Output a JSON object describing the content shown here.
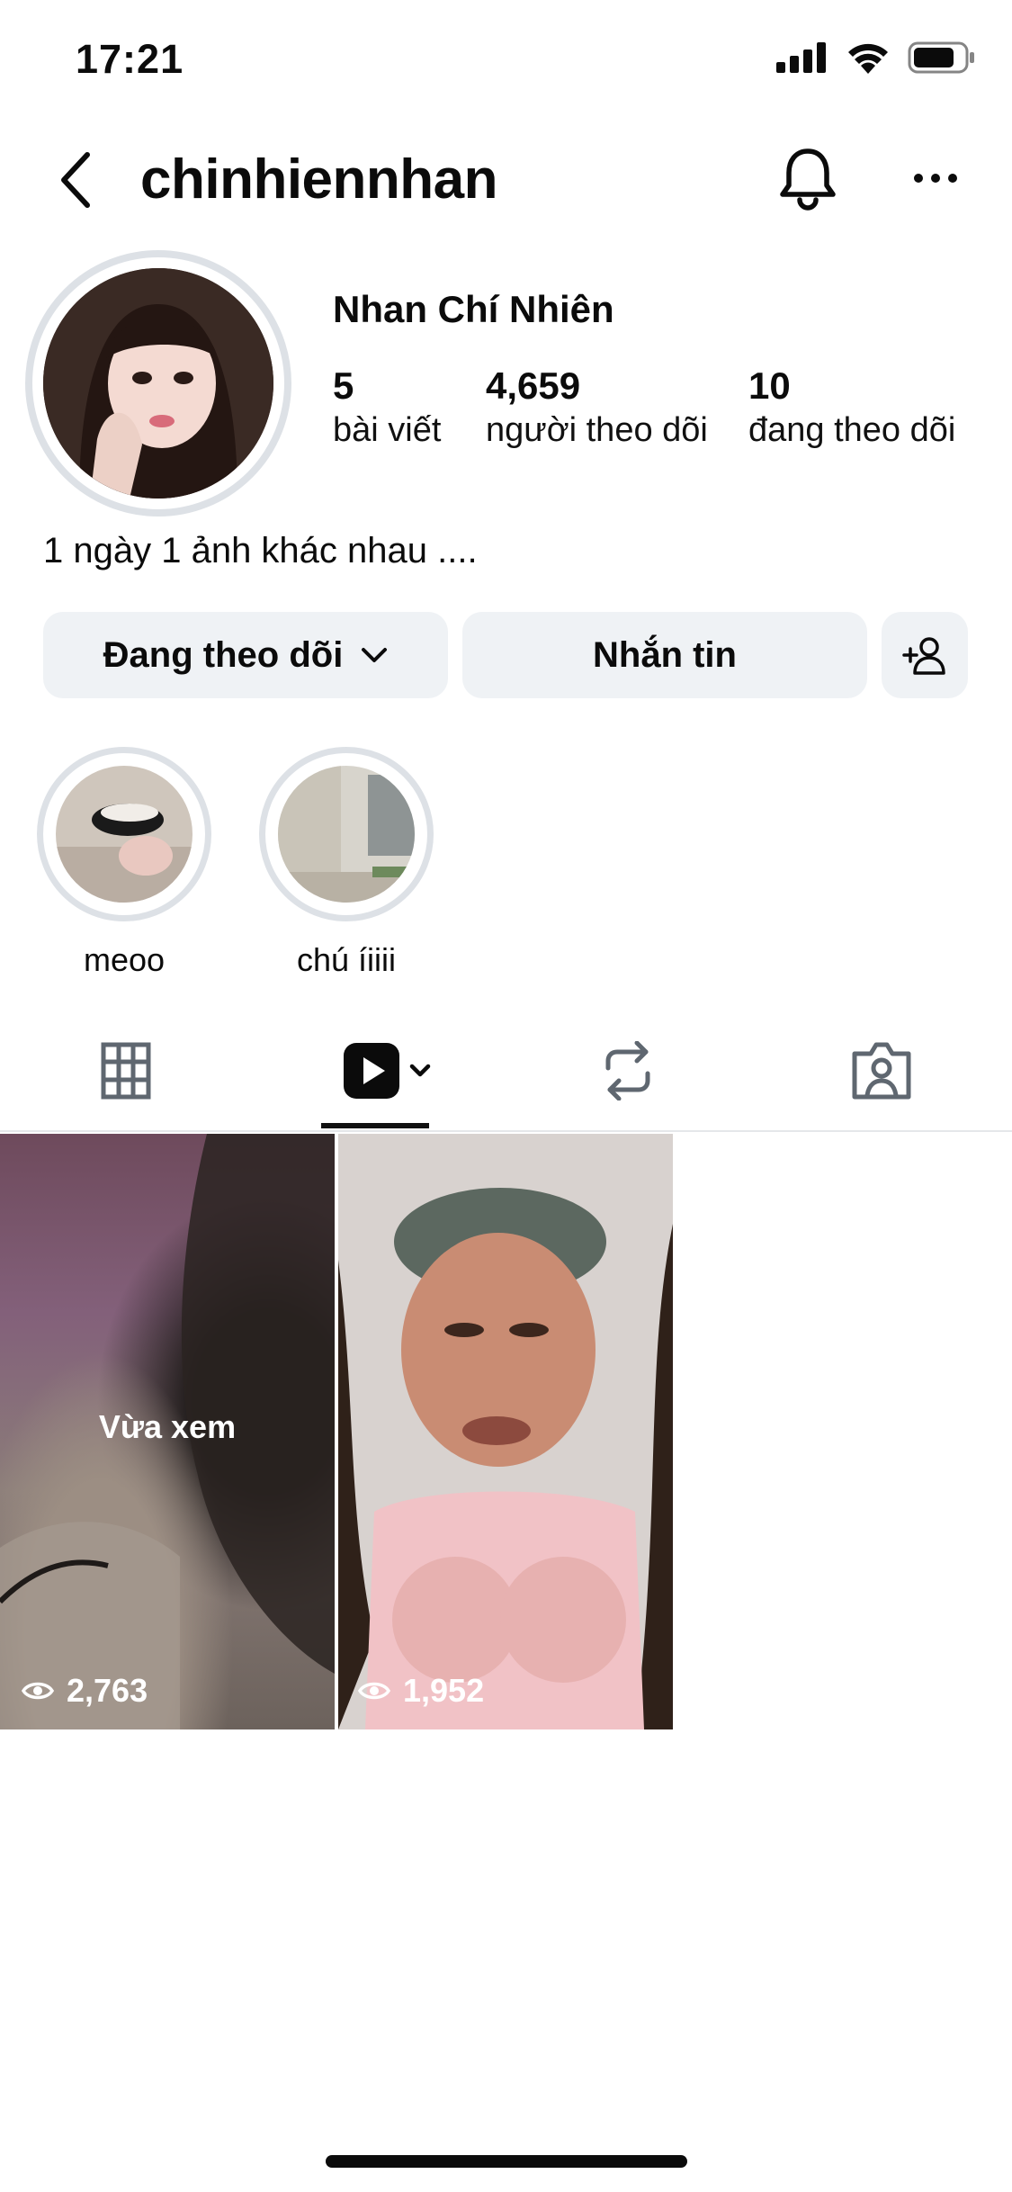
{
  "status_bar": {
    "time": "17:21"
  },
  "header": {
    "username": "chinhiennhan",
    "icons": [
      "back-icon",
      "bell-icon",
      "more-icon"
    ]
  },
  "profile": {
    "display_name": "Nhan Chí Nhiên",
    "stats": [
      {
        "value": "5",
        "label": "bài viết"
      },
      {
        "value": "4,659",
        "label": "người theo dõi"
      },
      {
        "value": "10",
        "label": "đang theo dõi"
      }
    ],
    "bio": "1 ngày 1 ảnh khác nhau ...."
  },
  "actions": {
    "following_label": "Đang theo dõi",
    "message_label": "Nhắn tin"
  },
  "highlights": [
    {
      "label": "meoo"
    },
    {
      "label": "chú íiiii"
    }
  ],
  "tabs": [
    {
      "name": "grid",
      "icon": "grid-icon",
      "active": false
    },
    {
      "name": "reels",
      "icon": "reels-icon",
      "active": true
    },
    {
      "name": "reposts",
      "icon": "repost-icon",
      "active": false
    },
    {
      "name": "tagged",
      "icon": "tagged-icon",
      "active": false
    }
  ],
  "reels": [
    {
      "overlay": "Vừa xem",
      "views": "2,763"
    },
    {
      "overlay": "",
      "views": "1,952"
    }
  ],
  "colors": {
    "button_bg": "#eff2f5",
    "ring": "#dde1e6",
    "text": "#0b0b0b"
  }
}
